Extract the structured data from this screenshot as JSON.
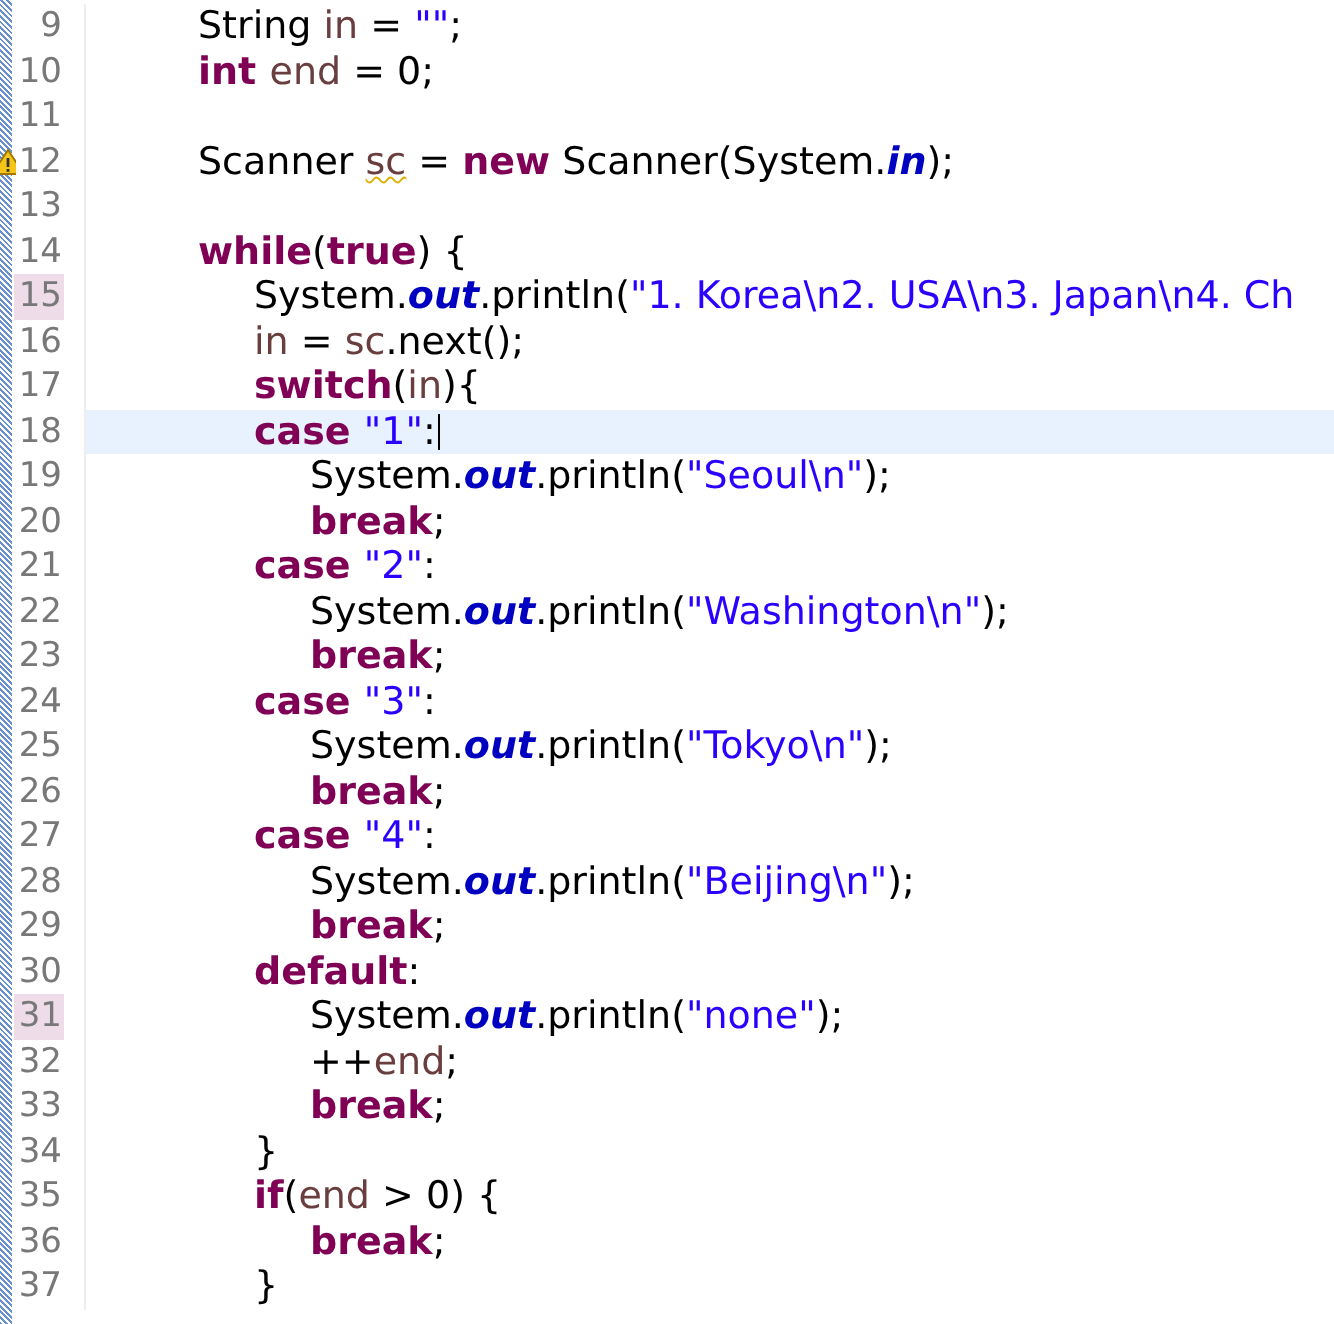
{
  "editor": {
    "lines": [
      {
        "number": "9",
        "tokens": [
          {
            "text": "String ",
            "kind": "plain"
          },
          {
            "text": "in",
            "kind": "local"
          },
          {
            "text": " = ",
            "kind": "plain"
          },
          {
            "text": "\"\"",
            "kind": "string"
          },
          {
            "text": ";",
            "kind": "plain"
          }
        ]
      },
      {
        "number": "10",
        "tokens": [
          {
            "text": "int ",
            "kind": "keyword"
          },
          {
            "text": "end",
            "kind": "local"
          },
          {
            "text": " = 0;",
            "kind": "plain"
          }
        ]
      },
      {
        "number": "11"
      },
      {
        "number": "12",
        "warning": true,
        "tokens": [
          {
            "text": "Scanner ",
            "kind": "plain"
          },
          {
            "text": "sc",
            "kind": "local",
            "warning": true
          },
          {
            "text": " = ",
            "kind": "plain"
          },
          {
            "text": "new",
            "kind": "keyword"
          },
          {
            "text": " Scanner(System.",
            "kind": "plain"
          },
          {
            "text": "in",
            "kind": "field"
          },
          {
            "text": ");",
            "kind": "plain"
          }
        ]
      },
      {
        "number": "13"
      },
      {
        "number": "14",
        "tokens": [
          {
            "text": "while",
            "kind": "keyword"
          },
          {
            "text": "(",
            "kind": "plain"
          },
          {
            "text": "true",
            "kind": "keyword"
          },
          {
            "text": ") {",
            "kind": "plain"
          }
        ],
        "children": [
          {
            "number": "15",
            "marked": true,
            "tokens": [
              {
                "text": "System.",
                "kind": "plain"
              },
              {
                "text": "out",
                "kind": "field"
              },
              {
                "text": ".println(",
                "kind": "plain"
              },
              {
                "text": "\"1. Korea\\n2. USA\\n3. Japan\\n4. Ch",
                "kind": "string"
              }
            ]
          },
          {
            "number": "16",
            "tokens": [
              {
                "text": "in",
                "kind": "local"
              },
              {
                "text": " = ",
                "kind": "plain"
              },
              {
                "text": "sc",
                "kind": "local"
              },
              {
                "text": ".next();",
                "kind": "plain"
              }
            ]
          },
          {
            "number": "17",
            "tokens": [
              {
                "text": "switch",
                "kind": "keyword"
              },
              {
                "text": "(",
                "kind": "plain"
              },
              {
                "text": "in",
                "kind": "local"
              },
              {
                "text": "){",
                "kind": "plain"
              }
            ]
          },
          {
            "number": "18",
            "current": true,
            "caret": true,
            "tokens": [
              {
                "text": "case ",
                "kind": "keyword"
              },
              {
                "text": "\"1\"",
                "kind": "string"
              },
              {
                "text": ":",
                "kind": "plain"
              }
            ],
            "children": [
              {
                "number": "19",
                "tokens": [
                  {
                    "text": "System.",
                    "kind": "plain"
                  },
                  {
                    "text": "out",
                    "kind": "field"
                  },
                  {
                    "text": ".println(",
                    "kind": "plain"
                  },
                  {
                    "text": "\"Seoul\\n\"",
                    "kind": "string"
                  },
                  {
                    "text": ");",
                    "kind": "plain"
                  }
                ]
              },
              {
                "number": "20",
                "tokens": [
                  {
                    "text": "break",
                    "kind": "keyword"
                  },
                  {
                    "text": ";",
                    "kind": "plain"
                  }
                ]
              }
            ]
          },
          {
            "number": "21",
            "tokens": [
              {
                "text": "case ",
                "kind": "keyword"
              },
              {
                "text": "\"2\"",
                "kind": "string"
              },
              {
                "text": ":",
                "kind": "plain"
              }
            ],
            "children": [
              {
                "number": "22",
                "tokens": [
                  {
                    "text": "System.",
                    "kind": "plain"
                  },
                  {
                    "text": "out",
                    "kind": "field"
                  },
                  {
                    "text": ".println(",
                    "kind": "plain"
                  },
                  {
                    "text": "\"Washington\\n\"",
                    "kind": "string"
                  },
                  {
                    "text": ");",
                    "kind": "plain"
                  }
                ]
              },
              {
                "number": "23",
                "tokens": [
                  {
                    "text": "break",
                    "kind": "keyword"
                  },
                  {
                    "text": ";",
                    "kind": "plain"
                  }
                ]
              }
            ]
          },
          {
            "number": "24",
            "tokens": [
              {
                "text": "case ",
                "kind": "keyword"
              },
              {
                "text": "\"3\"",
                "kind": "string"
              },
              {
                "text": ":",
                "kind": "plain"
              }
            ],
            "children": [
              {
                "number": "25",
                "tokens": [
                  {
                    "text": "System.",
                    "kind": "plain"
                  },
                  {
                    "text": "out",
                    "kind": "field"
                  },
                  {
                    "text": ".println(",
                    "kind": "plain"
                  },
                  {
                    "text": "\"Tokyo\\n\"",
                    "kind": "string"
                  },
                  {
                    "text": ");",
                    "kind": "plain"
                  }
                ]
              },
              {
                "number": "26",
                "tokens": [
                  {
                    "text": "break",
                    "kind": "keyword"
                  },
                  {
                    "text": ";",
                    "kind": "plain"
                  }
                ]
              }
            ]
          },
          {
            "number": "27",
            "tokens": [
              {
                "text": "case ",
                "kind": "keyword"
              },
              {
                "text": "\"4\"",
                "kind": "string"
              },
              {
                "text": ":",
                "kind": "plain"
              }
            ],
            "children": [
              {
                "number": "28",
                "tokens": [
                  {
                    "text": "System.",
                    "kind": "plain"
                  },
                  {
                    "text": "out",
                    "kind": "field"
                  },
                  {
                    "text": ".println(",
                    "kind": "plain"
                  },
                  {
                    "text": "\"Beijing\\n\"",
                    "kind": "string"
                  },
                  {
                    "text": ");",
                    "kind": "plain"
                  }
                ]
              },
              {
                "number": "29",
                "tokens": [
                  {
                    "text": "break",
                    "kind": "keyword"
                  },
                  {
                    "text": ";",
                    "kind": "plain"
                  }
                ]
              }
            ]
          },
          {
            "number": "30",
            "tokens": [
              {
                "text": "default",
                "kind": "keyword"
              },
              {
                "text": ":",
                "kind": "plain"
              }
            ],
            "children": [
              {
                "number": "31",
                "marked": true,
                "tokens": [
                  {
                    "text": "System.",
                    "kind": "plain"
                  },
                  {
                    "text": "out",
                    "kind": "field"
                  },
                  {
                    "text": ".println(",
                    "kind": "plain"
                  },
                  {
                    "text": "\"none\"",
                    "kind": "string"
                  },
                  {
                    "text": ");",
                    "kind": "plain"
                  }
                ]
              },
              {
                "number": "32",
                "tokens": [
                  {
                    "text": "++",
                    "kind": "plain"
                  },
                  {
                    "text": "end",
                    "kind": "local"
                  },
                  {
                    "text": ";",
                    "kind": "plain"
                  }
                ]
              },
              {
                "number": "33",
                "tokens": [
                  {
                    "text": "break",
                    "kind": "keyword"
                  },
                  {
                    "text": ";",
                    "kind": "plain"
                  }
                ]
              }
            ]
          },
          {
            "number": "34",
            "tokens": [
              {
                "text": "}",
                "kind": "plain"
              }
            ]
          },
          {
            "number": "35",
            "tokens": [
              {
                "text": "if",
                "kind": "keyword"
              },
              {
                "text": "(",
                "kind": "plain"
              },
              {
                "text": "end",
                "kind": "local"
              },
              {
                "text": " > 0) {",
                "kind": "plain"
              }
            ],
            "children": [
              {
                "number": "36",
                "tokens": [
                  {
                    "text": "break",
                    "kind": "keyword"
                  },
                  {
                    "text": ";",
                    "kind": "plain"
                  }
                ]
              }
            ]
          },
          {
            "number": "37",
            "tokens": [
              {
                "text": "}",
                "kind": "plain"
              }
            ]
          }
        ]
      }
    ]
  }
}
